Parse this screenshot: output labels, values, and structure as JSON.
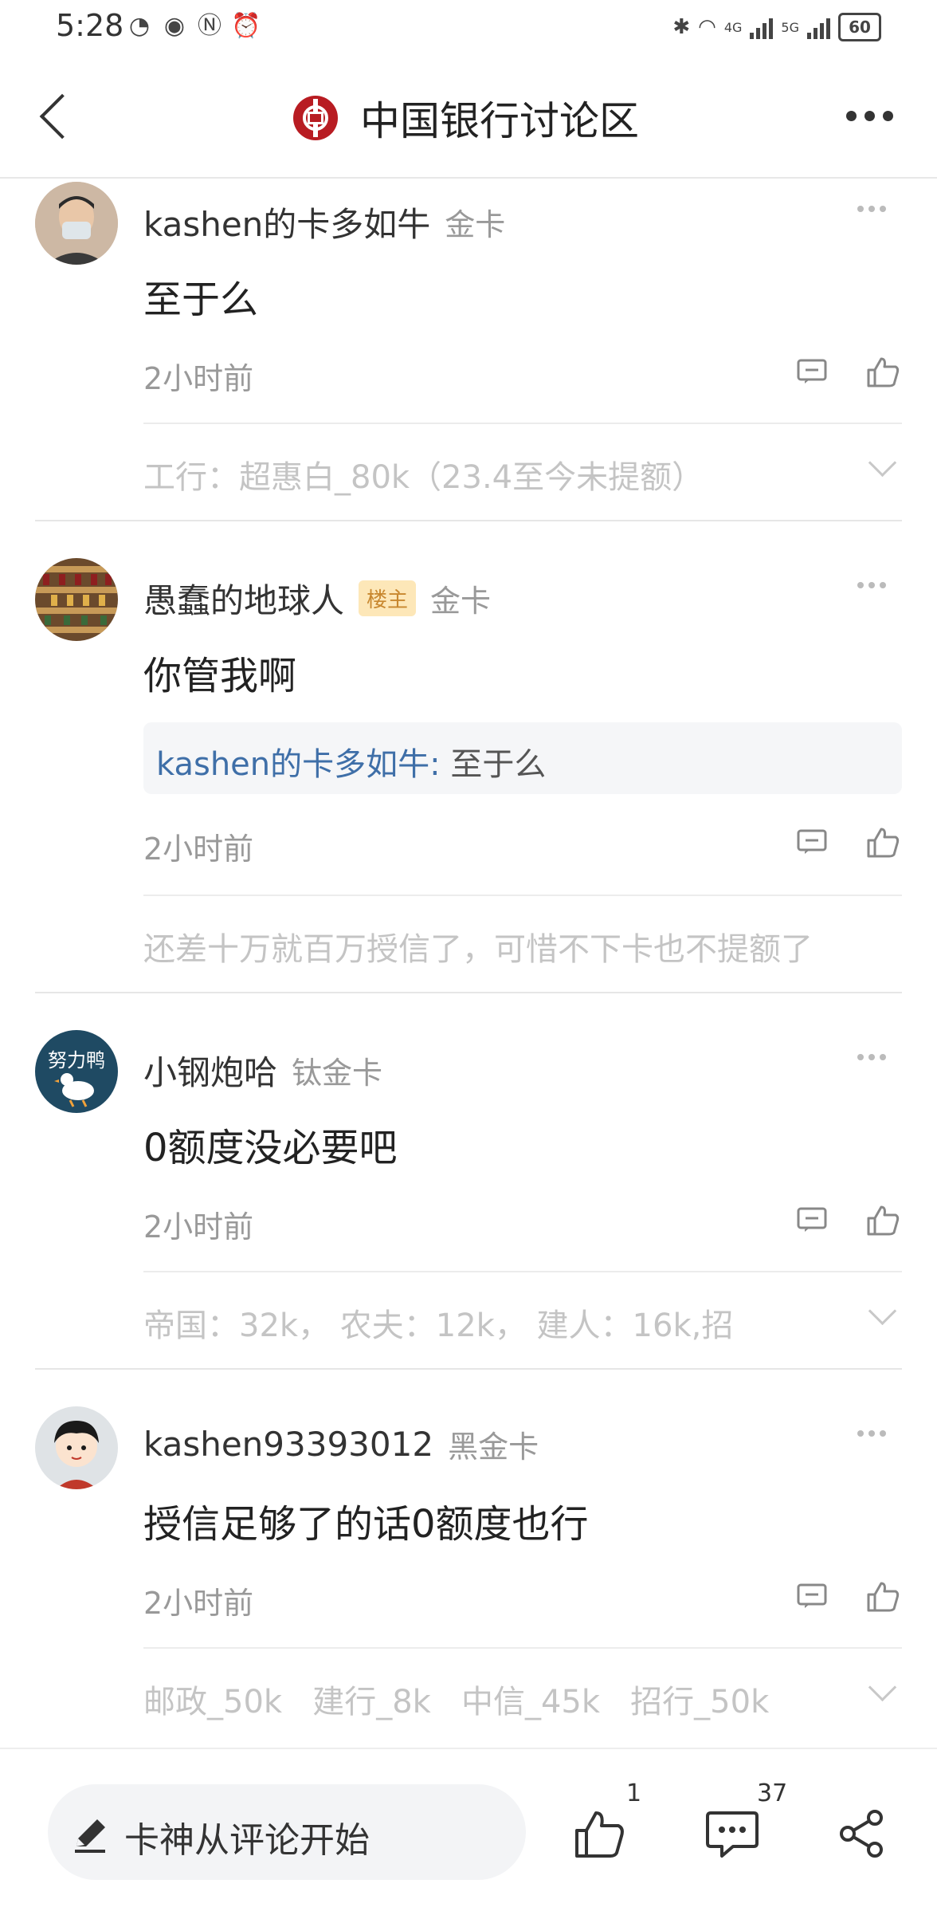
{
  "status_bar": {
    "time": "5:28",
    "battery": "60",
    "net_4g": "4G",
    "net_5g": "5G"
  },
  "header": {
    "title": "中国银行讨论区"
  },
  "comments": [
    {
      "username": "kashen的卡多如牛",
      "op_badge": "",
      "rank": "金卡",
      "text": "至于么",
      "quote": null,
      "time": "2小时前",
      "signature": "工行：超惠白_80k（23.4至今未提额）"
    },
    {
      "username": "愚蠢的地球人",
      "op_badge": "楼主",
      "rank": "金卡",
      "text": "你管我啊",
      "quote": {
        "name": "kashen的卡多如牛:",
        "body": " 至于么"
      },
      "time": "2小时前",
      "signature": "还差十万就百万授信了，可惜不下卡也不提额了"
    },
    {
      "username": "小钢炮哈",
      "op_badge": "",
      "rank": "钛金卡",
      "text": "0额度没必要吧",
      "quote": null,
      "time": "2小时前",
      "signature": "帝国：32k， 农夫：12k， 建人：16k,招"
    },
    {
      "username": "kashen93393012",
      "op_badge": "",
      "rank": "黑金卡",
      "text": "授信足够了的话0额度也行",
      "quote": null,
      "time": "2小时前",
      "signature": "邮政_50k   建行_8k   中信_45k   招行_50k"
    }
  ],
  "bottom_bar": {
    "input_placeholder": "卡神从评论开始",
    "like_count": "1",
    "comment_count": "37"
  },
  "icons": {
    "back": "back-arrow-icon",
    "more": "more-dots-icon",
    "reply": "reply-icon",
    "like": "thumbs-up-icon",
    "pen": "pen-icon",
    "comment": "comment-bubble-icon",
    "share": "share-icon"
  },
  "colors": {
    "brand_red": "#b81c22",
    "quote_name": "#3f6fa8",
    "op_badge_bg": "#fde7b8",
    "op_badge_text": "#c8872f"
  }
}
